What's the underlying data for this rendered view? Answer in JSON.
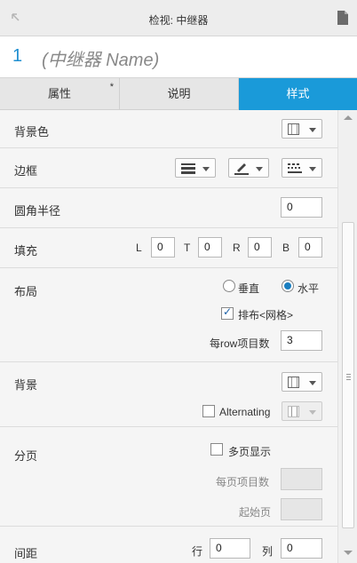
{
  "header": {
    "title": "检视: 中继器"
  },
  "name": {
    "number": "1",
    "placeholder": "(中继器 Name)"
  },
  "tabs": [
    {
      "label": "属性",
      "marker": "*"
    },
    {
      "label": "说明"
    },
    {
      "label": "样式",
      "active": true
    }
  ],
  "style": {
    "fill_color": {
      "label": "背景色"
    },
    "border": {
      "label": "边框"
    },
    "corner_radius": {
      "label": "圆角半径",
      "value": "0"
    },
    "padding": {
      "label": "填充",
      "left_label": "L",
      "left": "0",
      "top_label": "T",
      "top": "0",
      "right_label": "R",
      "right": "0",
      "bottom_label": "B",
      "bottom": "0"
    },
    "layout": {
      "label": "布局",
      "vertical_label": "垂直",
      "horizontal_label": "水平",
      "selected": "水平",
      "wrap_label": "排布<网格>",
      "wrap_checked": true,
      "items_per_row_label": "每row项目数",
      "items_per_row": "3"
    },
    "background": {
      "label": "背景",
      "alternating_label": "Alternating",
      "alternating_checked": false
    },
    "pagination": {
      "label": "分页",
      "multi_page_label": "多页显示",
      "multi_page_checked": false,
      "items_per_page_label": "每页项目数",
      "start_page_label": "起始页"
    },
    "spacing": {
      "label": "间距",
      "row_label": "行",
      "row": "0",
      "column_label": "列",
      "column": "0"
    }
  },
  "colors": {
    "accent": "#1a9ad9",
    "name_number": "#1f8fd1"
  }
}
